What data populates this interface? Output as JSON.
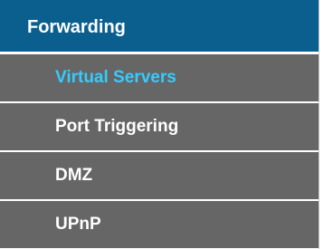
{
  "menu": {
    "section": {
      "title": "Forwarding",
      "background": "#0b5f8f",
      "text_color": "#ffffff"
    },
    "items": [
      {
        "label": "Virtual Servers",
        "active": true,
        "text_color": "#33ccff"
      },
      {
        "label": "Port Triggering",
        "active": false,
        "text_color": "#ffffff"
      },
      {
        "label": "DMZ",
        "active": false,
        "text_color": "#ffffff"
      },
      {
        "label": "UPnP",
        "active": false,
        "text_color": "#ffffff"
      }
    ],
    "item_background": "#666666"
  }
}
